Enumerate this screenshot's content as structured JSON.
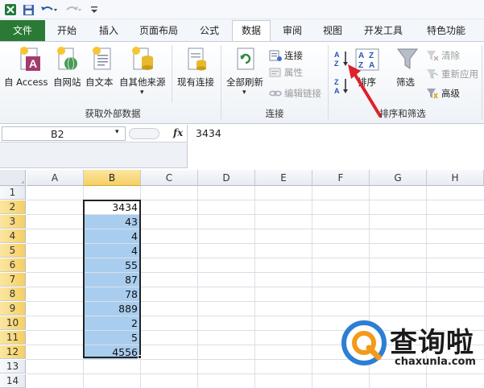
{
  "tabs": [
    "文件",
    "开始",
    "插入",
    "页面布局",
    "公式",
    "数据",
    "审阅",
    "视图",
    "开发工具",
    "特色功能"
  ],
  "active_tab": "数据",
  "ribbon": {
    "external": {
      "access": "自 Access",
      "web": "自网站",
      "text": "自文本",
      "other": "自其他来源",
      "existing": "现有连接",
      "group_label": "获取外部数据"
    },
    "connections": {
      "refresh_all": "全部刷新",
      "connect": "连接",
      "properties": "属性",
      "edit_links": "编辑链接",
      "group_label": "连接"
    },
    "sort_filter": {
      "sort": "排序",
      "filter": "筛选",
      "clear": "清除",
      "reapply": "重新应用",
      "advanced": "高级",
      "group_label": "排序和筛选"
    }
  },
  "formula_bar": {
    "name_box": "B2",
    "fx": "fx",
    "value": "3434"
  },
  "grid": {
    "columns": [
      "A",
      "B",
      "C",
      "D",
      "E",
      "F",
      "G",
      "H"
    ],
    "rows": [
      "1",
      "2",
      "3",
      "4",
      "5",
      "6",
      "7",
      "8",
      "9",
      "10",
      "11",
      "12",
      "13",
      "14"
    ],
    "b_values": [
      "3434",
      "43",
      "4",
      "4",
      "55",
      "87",
      "78",
      "889",
      "2",
      "5",
      "4556"
    ]
  },
  "watermark": {
    "brand": "查询啦",
    "url": "chaxunla.com"
  },
  "colors": {
    "file_tab": "#2a7a36",
    "selection_fill": "#a9cdee",
    "header_highlight": "#f6cf63",
    "arrow": "#e0202a",
    "watermark_blue": "#2d7fd3"
  }
}
